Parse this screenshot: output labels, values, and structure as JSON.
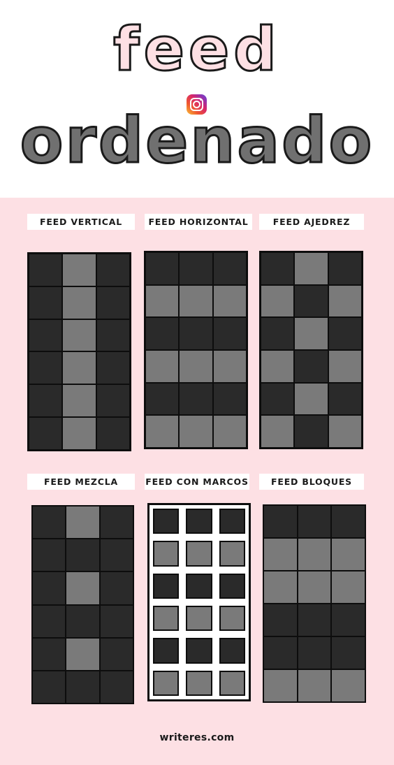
{
  "header": {
    "title_top": "feed",
    "title_bottom": "ordenado",
    "icon": "instagram-icon"
  },
  "layouts": [
    {
      "label": "FEED VERTICAL",
      "pattern": [
        "dld",
        "dld",
        "dld",
        "dld",
        "dld",
        "dld"
      ],
      "framed": false
    },
    {
      "label": "FEED HORIZONTAL",
      "pattern": [
        "ddd",
        "lll",
        "ddd",
        "lll",
        "ddd",
        "lll"
      ],
      "framed": false
    },
    {
      "label": "FEED AJEDREZ",
      "pattern": [
        "dld",
        "ldl",
        "dld",
        "ldl",
        "dld",
        "ldl"
      ],
      "framed": false
    },
    {
      "label": "FEED MEZCLA",
      "pattern": [
        "dld",
        "ddd",
        "dld",
        "ddd",
        "dld",
        "ddd"
      ],
      "framed": false
    },
    {
      "label": "FEED CON MARCOS",
      "pattern": [
        "ddd",
        "lll",
        "ddd",
        "lll",
        "ddd",
        "lll"
      ],
      "framed": true
    },
    {
      "label": "FEED BLOQUES",
      "pattern": [
        "ddd",
        "lll",
        "lll",
        "ddd",
        "ddd",
        "lll"
      ],
      "framed": false
    }
  ],
  "footer": {
    "site": "writeres.com"
  },
  "colors": {
    "pink": "#fde0e4",
    "dark": "#2a2a2a",
    "light": "#7a7a7a"
  }
}
